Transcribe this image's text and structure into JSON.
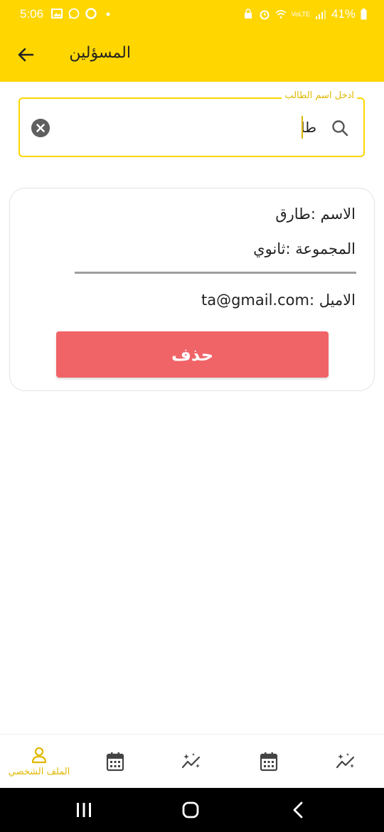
{
  "status_bar": {
    "time": "5:06",
    "battery": "41%",
    "network_label": "VoLTE"
  },
  "app_bar": {
    "title": "المسؤلين"
  },
  "search": {
    "label": "ادخل اسم الطالب",
    "value": "طا"
  },
  "student_card": {
    "name_row": "الاسم :طارق",
    "group_row": "المجموعة :ثانوي",
    "email_row": "الاميل :ta@gmail.com",
    "delete_label": "حذف"
  },
  "bottom_nav": {
    "items": [
      {
        "label": "الملف الشخصي",
        "icon": "person-icon",
        "active": true
      },
      {
        "label": "",
        "icon": "calendar-icon",
        "active": false
      },
      {
        "label": "",
        "icon": "sparkle-chart-icon",
        "active": false
      },
      {
        "label": "",
        "icon": "calendar-icon",
        "active": false
      },
      {
        "label": "",
        "icon": "sparkle-chart-icon",
        "active": false
      }
    ]
  },
  "colors": {
    "primary_yellow": "#FFD600",
    "accent_text_yellow": "#E0B800",
    "delete_red": "#F06468"
  }
}
